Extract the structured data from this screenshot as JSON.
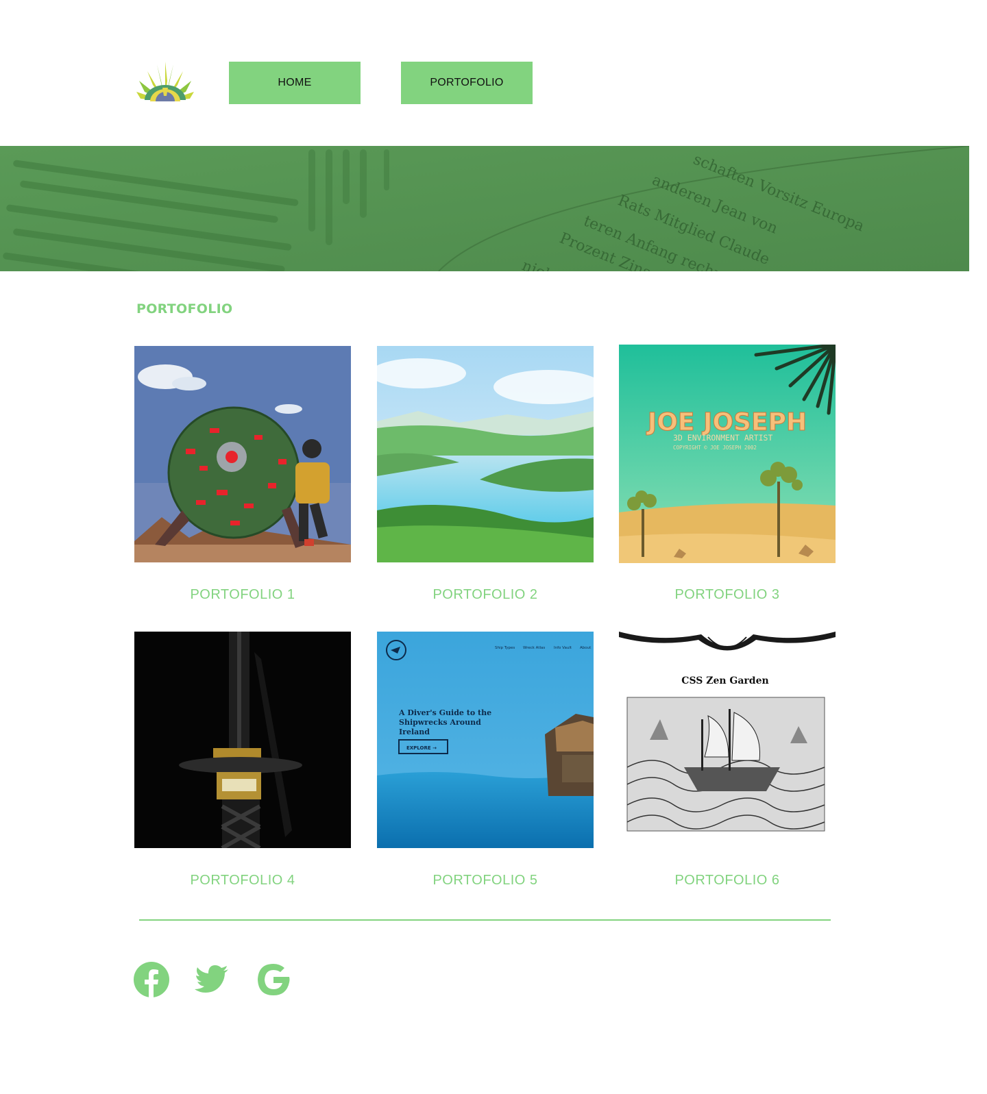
{
  "header": {
    "logo_icon": "peacock-fan-logo-icon",
    "nav": [
      {
        "label": "HOME"
      },
      {
        "label": "PORTOFOLIO"
      }
    ]
  },
  "banner": {
    "text_lines": [
      "nicht",
      "Prozent Zinsen",
      "teren Anfang rechnen",
      "Rats Mitglied Claude",
      "anderen Jean von",
      "schaften Vorsitz Europa"
    ]
  },
  "section": {
    "title": "PORTOFOLIO"
  },
  "portfolio": [
    {
      "label": "PORTOFOLIO 1"
    },
    {
      "label": "PORTOFOLIO 2"
    },
    {
      "label": "PORTOFOLIO 3",
      "image_text": {
        "name": "JOE JOSEPH",
        "role": "3D ENVIRONMENT ARTIST",
        "copyright": "COPYRIGHT © JOE JOSEPH 2002"
      }
    },
    {
      "label": "PORTOFOLIO 4"
    },
    {
      "label": "PORTOFOLIO 5",
      "image_text": {
        "nav": [
          "Ship Types",
          "Wreck Atlas",
          "Info Vault",
          "About"
        ],
        "heading_lines": [
          "A Diver's Guide to the",
          "Shipwrecks Around",
          "Ireland"
        ],
        "button": "EXPLORE →"
      }
    },
    {
      "label": "PORTOFOLIO 6",
      "image_text": {
        "title": "CSS Zen Garden"
      }
    }
  ],
  "footer": {
    "social": [
      "facebook-icon",
      "twitter-icon",
      "google-icon"
    ]
  },
  "colors": {
    "accent": "#82d37f",
    "banner": "#5e9d5c"
  }
}
